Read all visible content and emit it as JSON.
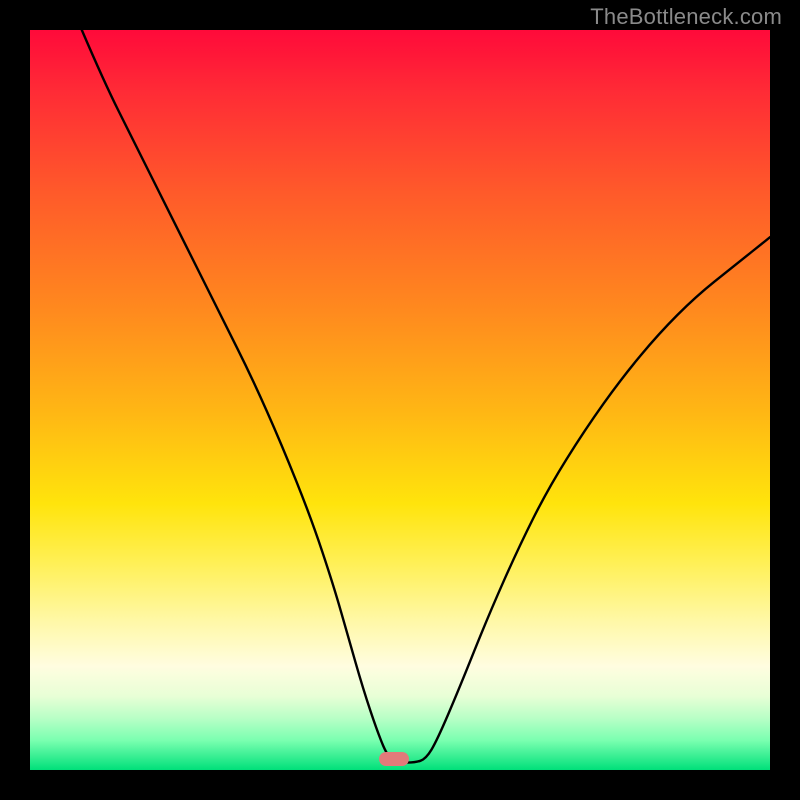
{
  "watermark": "TheBottleneck.com",
  "marker": {
    "color": "#e17a7a",
    "x_frac": 0.492,
    "y_frac": 0.985
  },
  "chart_data": {
    "type": "line",
    "title": "",
    "xlabel": "",
    "ylabel": "",
    "xlim": [
      0,
      100
    ],
    "ylim": [
      0,
      100
    ],
    "grid": false,
    "legend": false,
    "note": "Values estimated from pixel positions; higher y = closer to top (more bottleneck). The curve dips to ~0 near x≈49–52.",
    "series": [
      {
        "name": "bottleneck-curve",
        "x": [
          7,
          10,
          14,
          18,
          22,
          26,
          30,
          34,
          38,
          41,
          43,
          45,
          47,
          48.5,
          50,
          52,
          53.5,
          55,
          58,
          62,
          66,
          70,
          75,
          80,
          85,
          90,
          95,
          100
        ],
        "y": [
          100,
          93,
          85,
          77,
          69,
          61,
          53,
          44,
          34,
          25,
          18,
          11,
          5,
          1.5,
          1,
          1,
          1.5,
          4,
          11,
          21,
          30,
          38,
          46,
          53,
          59,
          64,
          68,
          72
        ]
      }
    ]
  }
}
